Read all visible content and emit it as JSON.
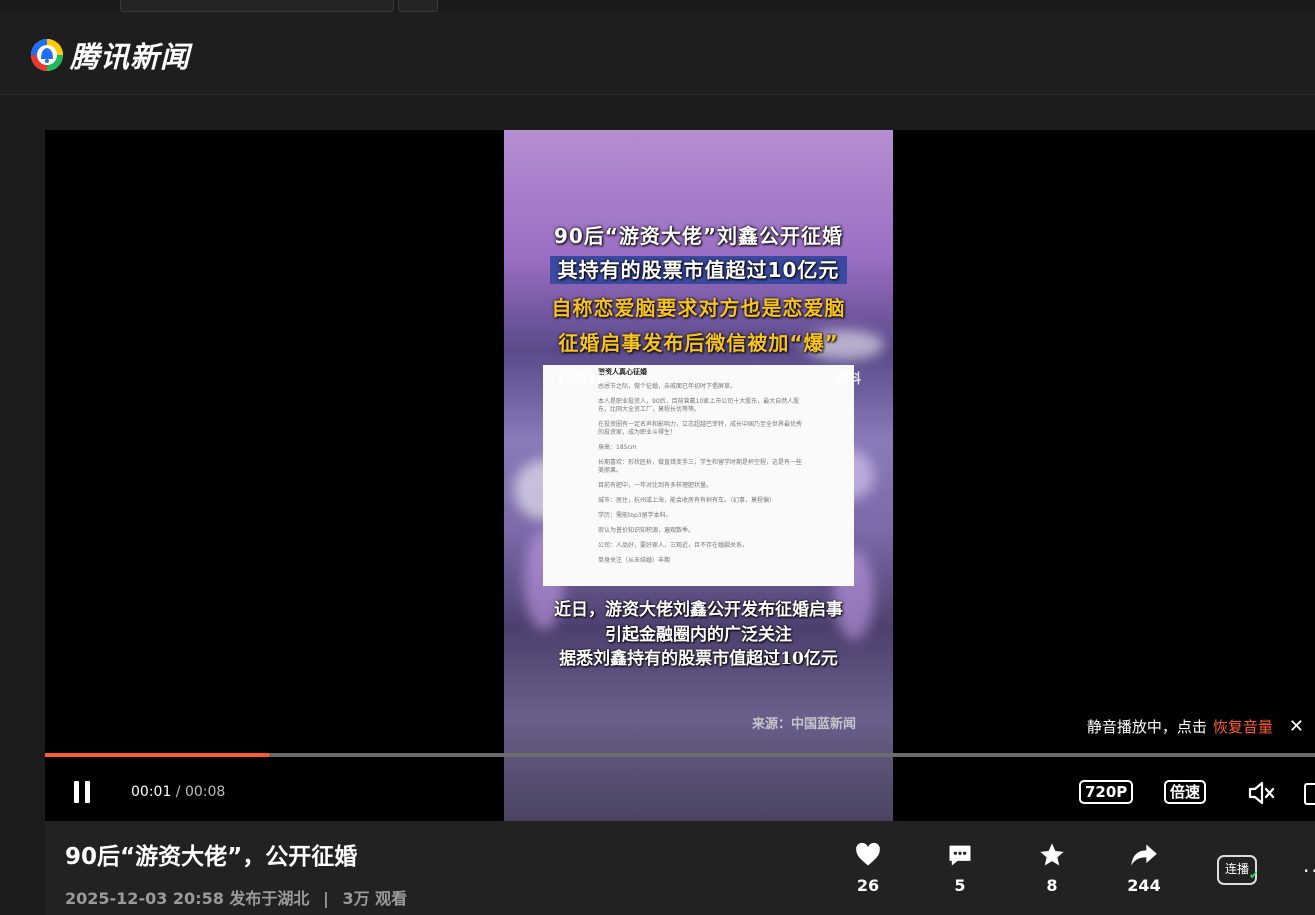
{
  "site": {
    "logo_text": "腾讯新闻"
  },
  "video_overlay": {
    "headline_1": "90后“游资大佬”刘鑫公开征婚",
    "headline_2": "其持有的股票市值超过10亿元",
    "headline_3": "自称恋爱脑要求对方也是恋爱脑",
    "headline_4": "征婚启事发布后微信被加“爆”",
    "date_tag": "12月3日",
    "source_tag": "资料",
    "doc_title": "游资人真心征婚",
    "doc_lines": [
      "感恩节之际，做个征婚，亲戚面已年初时下倡屏草。",
      "本人是职业投资人，90后，目前曾戴10家上市公司十大股东，最大自然人股东，比网大全资工厂，莫程长优等等。",
      "在投资圈有一定名声和影响力，立志超越巴菲特，成长中国乃至全世界最优秀的投资家，成为职业斗得生！",
      "身高：185cm",
      "长期喜欢：形状匠析，做直错变手三，学生和留学时期是杯空程，这是有一些美丽果。",
      "目前有肥中，一年对比到有多样理肥状量。",
      "城市：居住，杭州或上海，能会收房有有树有车。（幻事，莫程偏）",
      "学历：需能top3留学本科。",
      "崇认为普价知识知积源，遍观数季。",
      "公司：人品好，要好家人，三观近，且不存在婚姻关系。",
      "单身关注（从未结婚）丰期"
    ],
    "subtitle_1": "近日，游资大佬刘鑫公开发布征婚启事",
    "subtitle_2": "引起金融圈内的广泛关注",
    "subtitle_3": "据悉刘鑫持有的股票市值超过10亿元",
    "credit": "来源：中国蓝新闻"
  },
  "player": {
    "mute_tip": "静音播放中，点击",
    "restore_label": "恢复音量",
    "current_time": "00:01",
    "time_sep": " / ",
    "duration": "00:08",
    "progress": 0.175,
    "quality_label": "720P",
    "speed_label": "倍速"
  },
  "info": {
    "title": "90后“游资大佬”，公开征婚",
    "date": "2025-12-03 20:58",
    "location": "发布于湖北",
    "separator": "|",
    "views": "3万 观看",
    "likes": "26",
    "comments": "5",
    "favorites": "8",
    "shares": "244",
    "autoplay_label": "连播",
    "more_label": "···"
  },
  "colors": {
    "accent": "#ff5a2a",
    "background": "#1c1c1c",
    "autoplay_check": "#3ccf72"
  },
  "icons": [
    "logo-icon",
    "pause-icon",
    "mute-icon",
    "fullscreen-icon",
    "like-icon",
    "comment-icon",
    "favorite-icon",
    "share-icon",
    "close-icon"
  ]
}
